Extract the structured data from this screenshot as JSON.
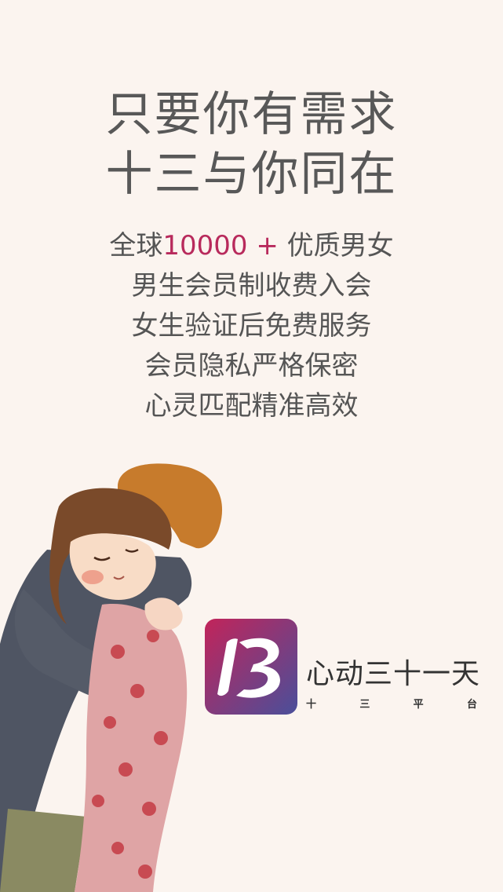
{
  "headline": {
    "line1": "只要你有需求",
    "line2": "十三与你同在"
  },
  "features": {
    "line1_prefix": "全球",
    "line1_highlight": "10000 +",
    "line1_suffix": " 优质男女",
    "line2": "男生会员制收费入会",
    "line3": "女生验证后免费服务",
    "line4": "会员隐私严格保密",
    "line5": "心灵匹配精准高效"
  },
  "brand": {
    "name": "心动三十一天",
    "sub": [
      "十",
      "三",
      "平",
      "台"
    ]
  },
  "colors": {
    "background": "#fbf4ef",
    "highlight": "#b82a5c",
    "logo_gradient_start": "#c2245a",
    "logo_gradient_end": "#4a4f9a"
  }
}
